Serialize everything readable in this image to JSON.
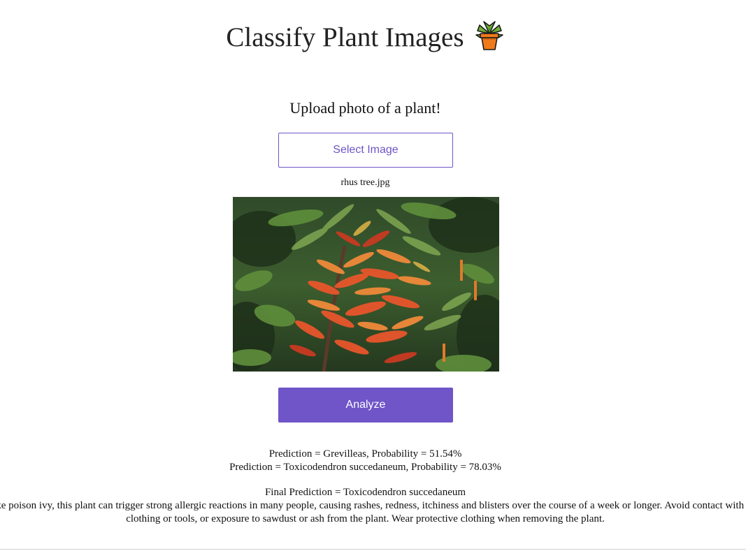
{
  "header": {
    "title": "Classify Plant Images",
    "title_icon": "potted-plant-icon"
  },
  "upload": {
    "prompt": "Upload photo of a plant!",
    "select_label": "Select Image",
    "filename": "rhus tree.jpg"
  },
  "actions": {
    "analyze_label": "Analyze"
  },
  "results": {
    "predictions": [
      "Prediction = Grevilleas, Probability = 51.54%",
      "Prediction = Toxicodendron succedaneum, Probability = 78.03%"
    ],
    "final": "Final Prediction = Toxicodendron succedaneum",
    "description": "Like poison ivy, this plant can trigger strong allergic reactions in many people, causing rashes, redness, itchiness and blisters over the course of a week or longer. Avoid contact with clothing or tools, or exposure to sawdust or ash from the plant. Wear protective clothing when removing the plant."
  },
  "colors": {
    "accent": "#6f55c8",
    "text": "#111111"
  }
}
